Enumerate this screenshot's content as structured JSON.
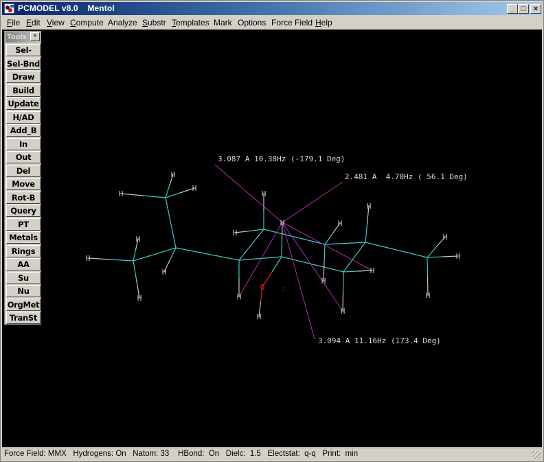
{
  "window": {
    "app_name": "PCMODEL v8.0",
    "document_title": "Mentol",
    "controls": {
      "minimize": "_",
      "maximize": "□",
      "close": "×"
    }
  },
  "menu": [
    {
      "label": "File",
      "accel": "F"
    },
    {
      "label": "Edit",
      "accel": "E"
    },
    {
      "label": "View",
      "accel": "V"
    },
    {
      "label": "Compute",
      "accel": "C"
    },
    {
      "label": "Analyze",
      "accel": ""
    },
    {
      "label": "Substr",
      "accel": "S"
    },
    {
      "label": "Templates",
      "accel": "T"
    },
    {
      "label": "Mark",
      "accel": ""
    },
    {
      "label": "Options",
      "accel": ""
    },
    {
      "label": "Force Field",
      "accel": ""
    },
    {
      "label": "Help",
      "accel": "H"
    }
  ],
  "toolbox": {
    "title": "Tools",
    "close_glyph": "×",
    "buttons": [
      "Sel-Atm",
      "Sel-Bnd",
      "Draw",
      "Build",
      "Update",
      "H/AD",
      "Add_B",
      "In",
      "Out",
      "Del",
      "Move",
      "Rot-B",
      "Query",
      "PT",
      "Metals",
      "Rings",
      "AA",
      "Su",
      "Nu",
      "OrgMet",
      "TranSt"
    ]
  },
  "status": {
    "force_field": "MMX",
    "hydrogens": "On",
    "natom": "33",
    "hbond": "On",
    "dielc": "1.5",
    "electstat": "q-q",
    "print": "min",
    "text": "Force Field: MMX   Hydrogens: On   Natom: 33    HBond:  On   Dielc:  1.5   Electstat:  q-q   Print:  min"
  },
  "colors": {
    "carbon_bond": "#40c8c8",
    "hydrogen": "#c8c8c8",
    "oxygen": "#e02020",
    "measurement": "#b030b0",
    "lone_pair": "#2030e0",
    "label_text": "#d8d8d8"
  },
  "molecule": {
    "name": "Mentol",
    "atoms": [
      {
        "id": "C1",
        "el": "C"
      },
      {
        "id": "C2",
        "el": "C"
      },
      {
        "id": "C3",
        "el": "C"
      },
      {
        "id": "C4",
        "el": "C"
      },
      {
        "id": "C5",
        "el": "C"
      },
      {
        "id": "C6",
        "el": "C"
      },
      {
        "id": "C7",
        "el": "C"
      },
      {
        "id": "C8",
        "el": "C"
      },
      {
        "id": "C9",
        "el": "C"
      },
      {
        "id": "C10",
        "el": "C"
      },
      {
        "id": "O1",
        "el": "O",
        "label": "O"
      },
      {
        "id": "H1",
        "el": "H",
        "label": "H"
      },
      {
        "id": "H2",
        "el": "H",
        "label": "H"
      },
      {
        "id": "H3",
        "el": "H",
        "label": "H"
      },
      {
        "id": "H4",
        "el": "H",
        "label": "H"
      },
      {
        "id": "H5",
        "el": "H",
        "label": "H"
      },
      {
        "id": "H6",
        "el": "H",
        "label": "H"
      },
      {
        "id": "H7",
        "el": "H",
        "label": "H"
      },
      {
        "id": "H8",
        "el": "H",
        "label": "H"
      },
      {
        "id": "H9",
        "el": "H",
        "label": "H"
      },
      {
        "id": "H10",
        "el": "H",
        "label": "H"
      },
      {
        "id": "H11",
        "el": "H",
        "label": "H"
      },
      {
        "id": "H12",
        "el": "H",
        "label": "H"
      },
      {
        "id": "H13",
        "el": "H",
        "label": "H"
      },
      {
        "id": "H14",
        "el": "H",
        "label": "H"
      },
      {
        "id": "H15",
        "el": "H",
        "label": "H"
      },
      {
        "id": "H16",
        "el": "H",
        "label": "H"
      },
      {
        "id": "H17",
        "el": "H",
        "label": "H"
      },
      {
        "id": "H18",
        "el": "H",
        "label": "H"
      },
      {
        "id": "H19",
        "el": "H",
        "label": "H"
      },
      {
        "id": "H20",
        "el": "H",
        "label": "H"
      }
    ],
    "measurements": [
      {
        "distance": "3.087 A",
        "coupling": "10.38Hz",
        "angle": "-179.1 Deg",
        "label": "3.087 A 10.38Hz (-179.1 Deg)"
      },
      {
        "distance": "2.481 A",
        "coupling": "4.70Hz",
        "angle": "56.1 Deg",
        "label": "2.481 A  4.70Hz ( 56.1 Deg)"
      },
      {
        "distance": "3.094 A",
        "coupling": "11.16Hz",
        "angle": "173.4 Deg",
        "label": "3.094 A 11.16Hz (173.4 Deg)"
      }
    ]
  }
}
